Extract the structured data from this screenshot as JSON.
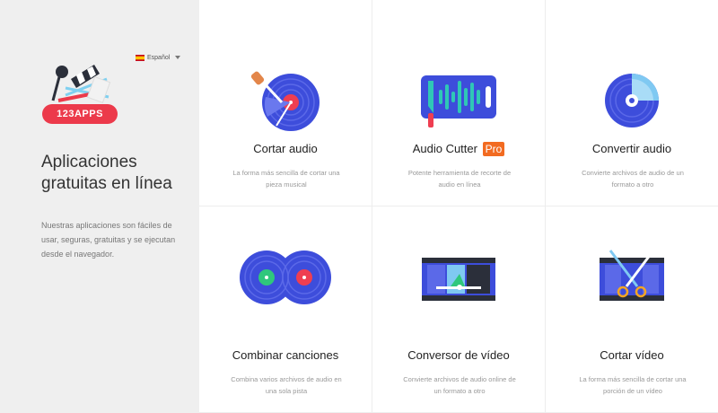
{
  "sidebar": {
    "language": "Español",
    "logo_text": "123APPS",
    "title": "Aplicaciones gratuitas en línea",
    "description": "Nuestras aplicaciones son fáciles de usar, seguras, gratuitas y se ejecutan desde el navegador."
  },
  "apps": [
    {
      "title": "Cortar audio",
      "badge": "",
      "description": "La forma más sencilla de cortar una pieza musical",
      "icon": "cut-audio-vinyl-icon"
    },
    {
      "title": "Audio Cutter",
      "badge": "Pro",
      "description": "Potente herramienta de recorte de audio en línea",
      "icon": "waveform-knife-icon"
    },
    {
      "title": "Convertir audio",
      "badge": "",
      "description": "Convierte archivos de audio de un formato a otro",
      "icon": "disc-convert-icon"
    },
    {
      "title": "Combinar canciones",
      "badge": "",
      "description": "Combina varios archivos de audio en una sola pista",
      "icon": "merge-vinyl-icon"
    },
    {
      "title": "Conversor de vídeo",
      "badge": "",
      "description": "Convierte archivos de audio online de un formato a otro",
      "icon": "video-convert-icon"
    },
    {
      "title": "Cortar vídeo",
      "badge": "",
      "description": "La forma más sencilla de cortar una porción de un vídeo",
      "icon": "video-scissors-icon"
    }
  ],
  "colors": {
    "sidebar_bg": "#efefef",
    "accent_red": "#ec3a4b",
    "icon_blue": "#3d4ddb",
    "pro_orange": "#f26b21",
    "teal": "#2fc7b6"
  }
}
